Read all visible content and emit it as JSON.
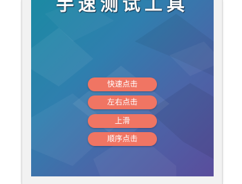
{
  "app": {
    "title": "手速测试工具"
  },
  "buttons": {
    "fast_click": "快速点击",
    "left_right_click": "左右点击",
    "swipe_up": "上滑",
    "sequential_click": "顺序点击"
  },
  "colors": {
    "button_bg": "#f07563",
    "button_text": "#ffffff",
    "background_start": "#1b8aa3",
    "background_end": "#5a4d9c"
  }
}
